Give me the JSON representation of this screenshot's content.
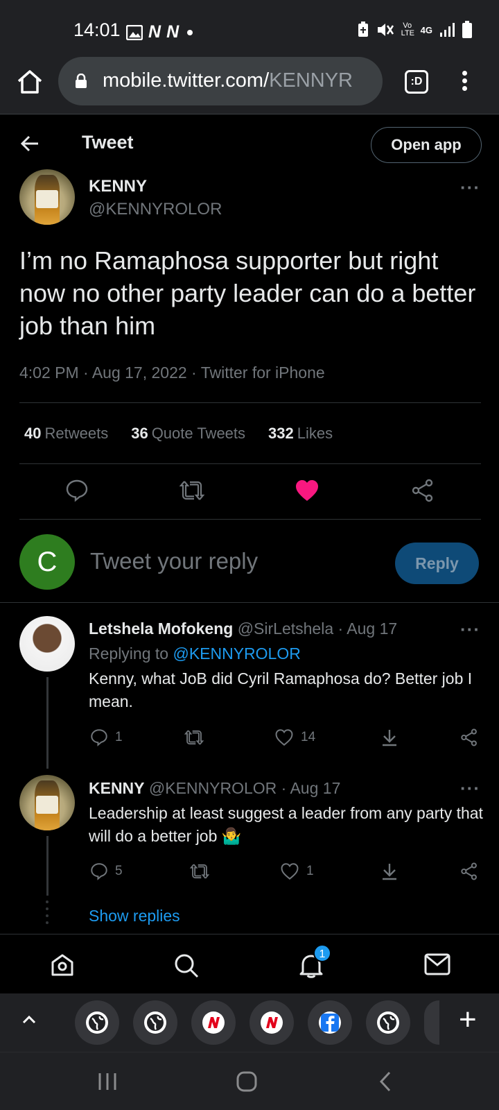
{
  "status_bar": {
    "time": "14:01",
    "notif_logo_1": "N",
    "notif_logo_2": "N",
    "network": "4G",
    "volte": "Vo LTE"
  },
  "browser": {
    "url_host": "mobile.twitter.com/",
    "url_path": "KENNYR",
    "tabs_label": ":D"
  },
  "header": {
    "title": "Tweet",
    "open_app": "Open app"
  },
  "tweet": {
    "author_name": "KENNY",
    "author_handle": "@KENNYROLOR",
    "text": "I’m no Ramaphosa supporter but right now no other party leader can do a better job than him",
    "meta": "4:02 PM · Aug 17, 2022 · Twitter for iPhone",
    "retweets": "40",
    "retweets_label": "Retweets",
    "quotes": "36",
    "quotes_label": "Quote Tweets",
    "likes": "332",
    "likes_label": "Likes",
    "like_color": "#f91880"
  },
  "composer": {
    "avatar_letter": "C",
    "placeholder": "Tweet your reply",
    "reply_label": "Reply"
  },
  "replies": [
    {
      "name": "Letshela Mofokeng",
      "handle_date": "@SirLetshela · Aug 17",
      "replying_prefix": "Replying to ",
      "replying_to": "@KENNYROLOR",
      "text": "Kenny, what JoB did Cyril Ramaphosa do? Better job I mean.",
      "reply_count": "1",
      "like_count": "14"
    },
    {
      "name": "KENNY",
      "handle_date": "@KENNYROLOR · Aug 17",
      "text": "Leadership at least suggest a leader from any party that will do a better job 🤷‍♂️",
      "reply_count": "5",
      "like_count": "1"
    }
  ],
  "show_replies": "Show replies",
  "notifications_badge": "1",
  "more_glyph": "···",
  "tab_strip": {
    "tabs": [
      "globe",
      "globe",
      "news-n",
      "news-n",
      "facebook",
      "globe",
      "partial"
    ]
  },
  "colors": {
    "accent": "#1d9bf0",
    "background": "#000000",
    "chrome": "#202124"
  }
}
